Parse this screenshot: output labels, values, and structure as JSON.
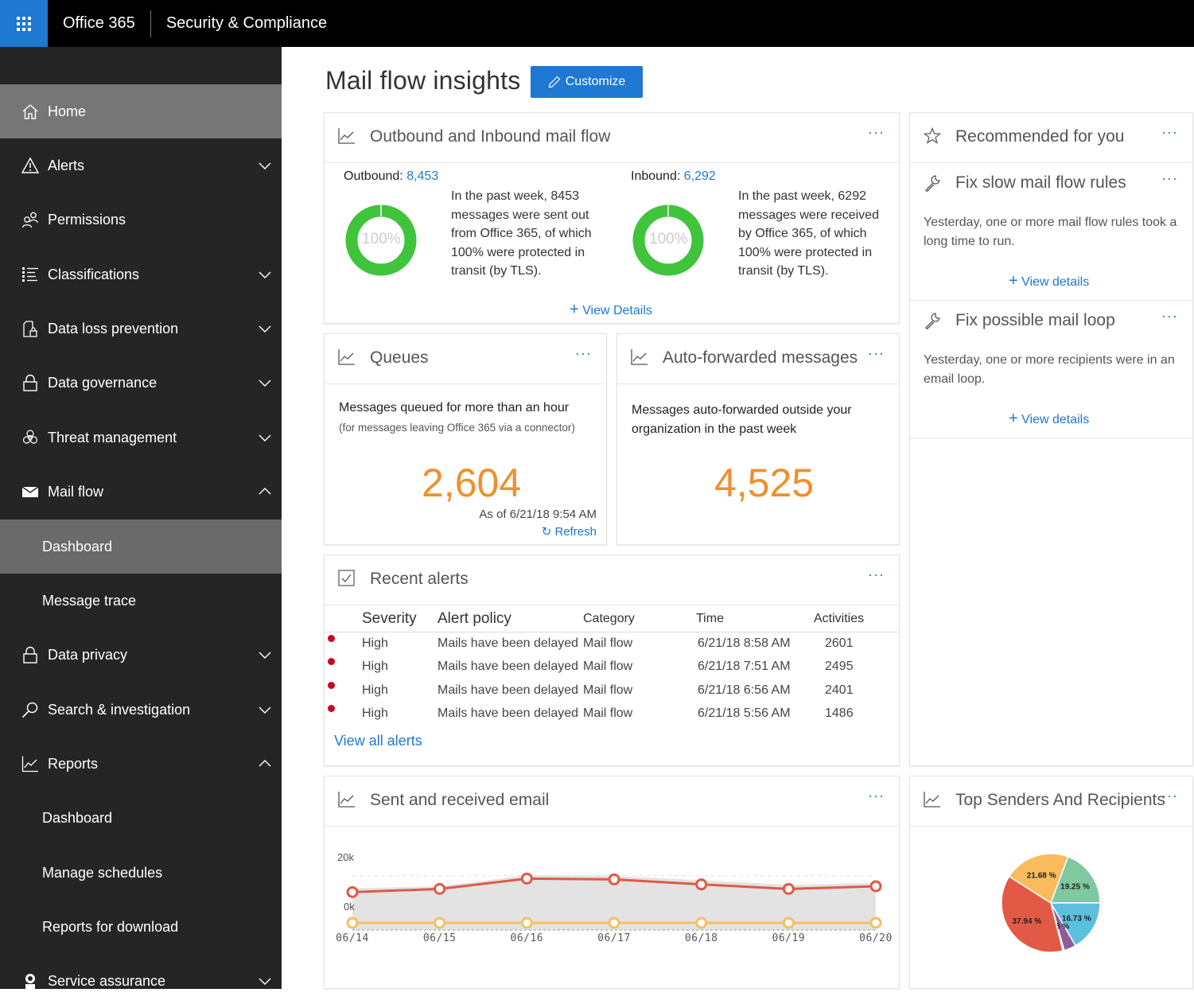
{
  "topbar": {
    "app_launcher_icon": "waffle-grid-icon",
    "brand": "Office 365",
    "app_title": "Security & Compliance"
  },
  "sidebar": {
    "items": [
      {
        "label": "Home",
        "icon": "home-icon",
        "state": "selected"
      },
      {
        "label": "Alerts",
        "icon": "warning-icon",
        "chevron": "down"
      },
      {
        "label": "Permissions",
        "icon": "people-icon"
      },
      {
        "label": "Classifications",
        "icon": "list-icon",
        "chevron": "down"
      },
      {
        "label": "Data loss prevention",
        "icon": "document-lock-icon",
        "chevron": "down"
      },
      {
        "label": "Data governance",
        "icon": "lock-icon",
        "chevron": "down"
      },
      {
        "label": "Threat management",
        "icon": "biohazard-icon",
        "chevron": "down"
      },
      {
        "label": "Mail flow",
        "icon": "mail-icon",
        "chevron": "up"
      },
      {
        "label": "Dashboard",
        "sub": true,
        "state": "selected"
      },
      {
        "label": "Message trace",
        "sub": true
      },
      {
        "label": "Data privacy",
        "icon": "lock-icon",
        "chevron": "down"
      },
      {
        "label": "Search & investigation",
        "icon": "search-icon",
        "chevron": "down"
      },
      {
        "label": "Reports",
        "icon": "chart-icon",
        "chevron": "up"
      },
      {
        "label": "Dashboard",
        "sub": true
      },
      {
        "label": "Manage schedules",
        "sub": true
      },
      {
        "label": "Reports for download",
        "sub": true
      },
      {
        "label": "Service assurance",
        "icon": "service-assurance-icon",
        "chevron": "down"
      }
    ]
  },
  "page": {
    "title": "Mail flow insights",
    "customize_label": "Customize"
  },
  "cards": {
    "mailflow": {
      "title": "Outbound and Inbound mail flow",
      "more": "···",
      "outbound_label": "Outbound:",
      "outbound_value": "8,453",
      "outbound_percent_label": "100%",
      "outbound_percent": 100,
      "outbound_desc": "In the past week, 8453 messages were sent out from Office 365, of which 100% were protected in transit (by TLS).",
      "inbound_label": "Inbound:",
      "inbound_value": "6,292",
      "inbound_percent_label": "100%",
      "inbound_percent": 100,
      "inbound_desc": "In the past week, 6292 messages were received by Office 365, of which 100% were protected in transit (by TLS).",
      "view_details": "View Details"
    },
    "recommended": {
      "title": "Recommended for you",
      "more": "···",
      "items": [
        {
          "title": "Fix slow mail flow rules",
          "desc": "Yesterday, one or more mail flow rules took a long time to run.",
          "link": "View details"
        },
        {
          "title": "Fix possible mail loop",
          "desc": "Yesterday, one or more recipients were in an email loop.",
          "link": "View details"
        }
      ]
    },
    "queues": {
      "title": "Queues",
      "more": "···",
      "heading": "Messages queued for more than an hour",
      "subheading": "(for messages leaving Office 365 via a connector)",
      "value": "2,604",
      "as_of": "As of 6/21/18 9:54 AM",
      "refresh": "Refresh"
    },
    "autoforward": {
      "title": "Auto-forwarded messages",
      "more": "···",
      "heading": "Messages auto-forwarded outside your organization in the past week",
      "value": "4,525"
    },
    "alerts": {
      "title": "Recent alerts",
      "more": "···",
      "columns": [
        "Severity",
        "Alert policy",
        "Category",
        "Time",
        "Activities"
      ],
      "rows": [
        {
          "severity": "High",
          "policy": "Mails have been delayed",
          "category": "Mail flow",
          "time": "6/21/18 8:58 AM",
          "activities": "2601"
        },
        {
          "severity": "High",
          "policy": "Mails have been delayed",
          "category": "Mail flow",
          "time": "6/21/18 7:51 AM",
          "activities": "2495"
        },
        {
          "severity": "High",
          "policy": "Mails have been delayed",
          "category": "Mail flow",
          "time": "6/21/18 6:56 AM",
          "activities": "2401"
        },
        {
          "severity": "High",
          "policy": "Mails have been delayed",
          "category": "Mail flow",
          "time": "6/21/18 5:56 AM",
          "activities": "1486"
        }
      ],
      "view_all": "View all alerts",
      "severity_color": "#d0021b"
    },
    "sent_received": {
      "title": "Sent and received email",
      "more": "···"
    },
    "top_senders": {
      "title": "Top Senders And Recipients",
      "more": "···"
    }
  },
  "colors": {
    "accent": "#1f78d1",
    "donut_green": "#3fc43b",
    "number_orange": "#f18f2a"
  },
  "chart_data": [
    {
      "type": "line",
      "title": "Sent and received email",
      "x": [
        "06/14",
        "06/15",
        "06/16",
        "06/17",
        "06/18",
        "06/19",
        "06/20"
      ],
      "ytick_labels": [
        "0k",
        "20k"
      ],
      "ylim": [
        -9000,
        33000
      ],
      "grid": true,
      "series": [
        {
          "name": "total-area",
          "type": "area",
          "color": "#e3e3e3",
          "values": [
            8200,
            9000,
            13200,
            12900,
            11300,
            9500,
            10300
          ]
        },
        {
          "name": "series-red",
          "color": "#e05a45",
          "values": [
            6800,
            8000,
            11900,
            11600,
            9700,
            8000,
            9000
          ]
        },
        {
          "name": "series-orange",
          "color": "#f7bf60",
          "values": [
            -4800,
            -4800,
            -4800,
            -4800,
            -4800,
            -4800,
            -4800
          ]
        }
      ]
    },
    {
      "type": "pie",
      "title": "Top Senders And Recipients",
      "slices": [
        {
          "label": "21.68 %",
          "value": 21.68,
          "color": "#f9bb5c"
        },
        {
          "label": "19.25 %",
          "value": 19.25,
          "color": "#7fc8a0"
        },
        {
          "label": "16.73 %",
          "value": 16.73,
          "color": "#5bc0de"
        },
        {
          "label": "",
          "value": 3.94,
          "color": "#8e5b9a"
        },
        {
          "label": "0.46 %",
          "value": 0.46,
          "color": "#c8c8c8"
        },
        {
          "label": "37.94 %",
          "value": 37.94,
          "color": "#e25a46"
        }
      ]
    }
  ]
}
